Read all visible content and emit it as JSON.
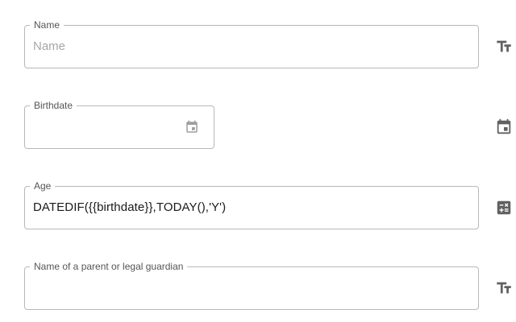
{
  "fields": [
    {
      "label": "Name",
      "value": "",
      "placeholder": "Name",
      "side_icon": "text-fields-icon"
    },
    {
      "label": "Birthdate",
      "value": "",
      "placeholder": "",
      "inline_icon": "calendar-icon",
      "side_icon": "calendar-icon"
    },
    {
      "label": "Age",
      "value": "DATEDIF({{birthdate}},TODAY(),'Y')",
      "placeholder": "",
      "side_icon": "calculator-icon"
    },
    {
      "label": "Name of a parent or legal guardian",
      "value": "",
      "placeholder": "",
      "side_icon": "text-fields-icon"
    }
  ],
  "colors": {
    "border": "#b8b8b8",
    "label": "#555555",
    "placeholder": "#a6a6a6",
    "icon": "#616161",
    "inline_icon": "#9e9e9e",
    "text": "#1a1a1a"
  }
}
